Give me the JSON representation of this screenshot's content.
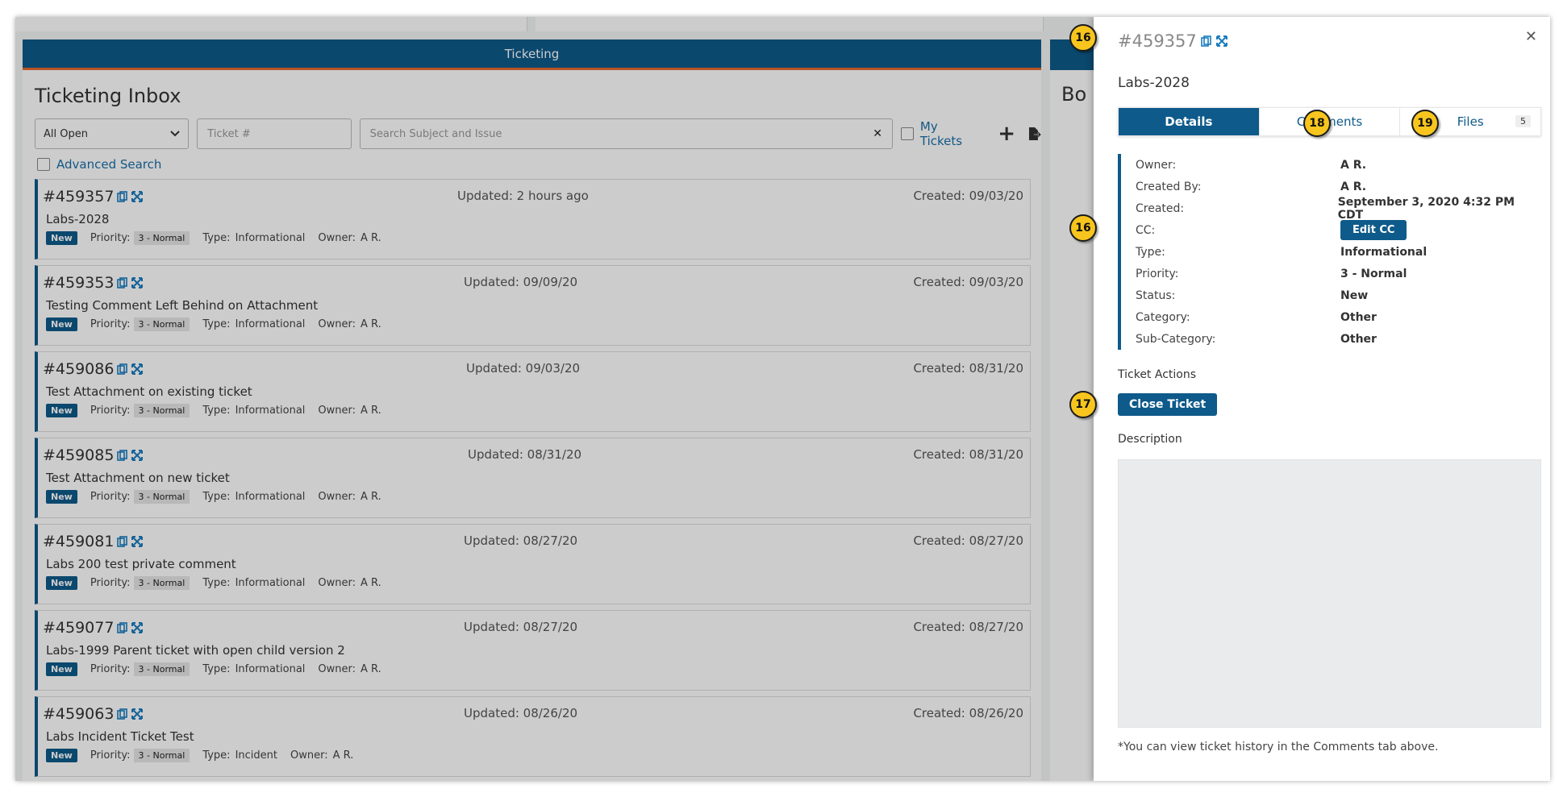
{
  "inbox": {
    "header": "Ticketing",
    "title": "Ticketing Inbox",
    "filter_select": "All Open",
    "ticket_placeholder": "Ticket #",
    "search_placeholder": "Search Subject and Issue",
    "my_tickets": "My Tickets",
    "advanced_search": "Advanced Search",
    "priority_label": "Priority:",
    "type_label": "Type:",
    "owner_label": "Owner:",
    "tickets": [
      {
        "number": "#459357",
        "updated": "Updated: 2 hours ago",
        "created": "Created: 09/03/20",
        "subject": "Labs-2028",
        "status": "New",
        "priority": "3 - Normal",
        "type": "Informational",
        "owner": "A R."
      },
      {
        "number": "#459353",
        "updated": "Updated: 09/09/20",
        "created": "Created: 09/03/20",
        "subject": "Testing Comment Left Behind on Attachment",
        "status": "New",
        "priority": "3 - Normal",
        "type": "Informational",
        "owner": "A R."
      },
      {
        "number": "#459086",
        "updated": "Updated: 09/03/20",
        "created": "Created: 08/31/20",
        "subject": "Test Attachment on existing ticket",
        "status": "New",
        "priority": "3 - Normal",
        "type": "Informational",
        "owner": "A R."
      },
      {
        "number": "#459085",
        "updated": "Updated: 08/31/20",
        "created": "Created: 08/31/20",
        "subject": "Test Attachment on new ticket",
        "status": "New",
        "priority": "3 - Normal",
        "type": "Informational",
        "owner": "A R."
      },
      {
        "number": "#459081",
        "updated": "Updated: 08/27/20",
        "created": "Created: 08/27/20",
        "subject": "Labs 200 test private comment",
        "status": "New",
        "priority": "3 - Normal",
        "type": "Informational",
        "owner": "A R."
      },
      {
        "number": "#459077",
        "updated": "Updated: 08/27/20",
        "created": "Created: 08/27/20",
        "subject": "Labs-1999 Parent ticket with open child version 2",
        "status": "New",
        "priority": "3 - Normal",
        "type": "Informational",
        "owner": "A R."
      },
      {
        "number": "#459063",
        "updated": "Updated: 08/26/20",
        "created": "Created: 08/26/20",
        "subject": "Labs Incident Ticket Test",
        "status": "New",
        "priority": "3 - Normal",
        "type": "Incident",
        "owner": "A R."
      }
    ]
  },
  "side_panel": {
    "title": "Bo"
  },
  "drawer": {
    "number": "#459357",
    "subject": "Labs-2028",
    "tabs": {
      "details": "Details",
      "comments": "Comments",
      "files": "Files",
      "files_count": "5"
    },
    "details": [
      {
        "label": "Owner:",
        "value": "A R."
      },
      {
        "label": "Created By:",
        "value": "A R."
      },
      {
        "label": "Created:",
        "value": "September 3, 2020 4:32 PM CDT"
      },
      {
        "label": "CC:",
        "value": ""
      },
      {
        "label": "Type:",
        "value": "Informational"
      },
      {
        "label": "Priority:",
        "value": "3 - Normal"
      },
      {
        "label": "Status:",
        "value": "New"
      },
      {
        "label": "Category:",
        "value": "Other"
      },
      {
        "label": "Sub-Category:",
        "value": "Other"
      }
    ],
    "edit_cc": "Edit CC",
    "actions_title": "Ticket Actions",
    "close_ticket": "Close Ticket",
    "description_title": "Description",
    "history_note": "*You can view ticket history in the Comments tab above."
  },
  "callouts": {
    "a": "16",
    "b": "18",
    "c": "19",
    "d": "16",
    "e": "17"
  },
  "colors": {
    "primary": "#0e5a8a",
    "accent": "#e86a2f",
    "callout": "#f7c51e"
  }
}
